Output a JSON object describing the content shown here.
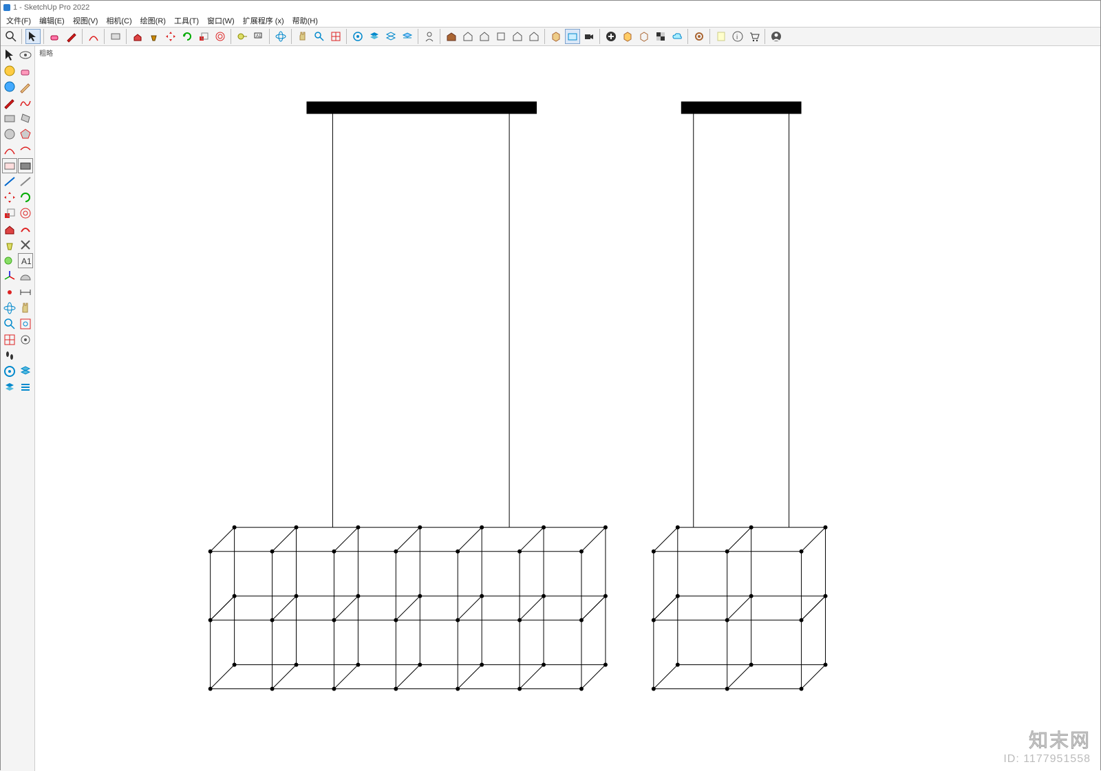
{
  "title": "1 - SketchUp Pro 2022",
  "menu": {
    "file": "文件(F)",
    "edit": "编辑(E)",
    "view": "视图(V)",
    "camera": "相机(C)",
    "draw": "绘图(R)",
    "tools": "工具(T)",
    "window": "窗口(W)",
    "extensions": "扩展程序 (x)",
    "help": "帮助(H)"
  },
  "canvas_label": "粗略",
  "watermark": {
    "brand": "知末网",
    "id_label": "ID: 1177951558"
  },
  "top_icons": [
    "search-icon",
    "select-arrow-icon",
    "eraser-icon",
    "pencil-icon",
    "arc-icon",
    "rectangle-icon",
    "pushpull-icon",
    "paintbucket-icon",
    "move-icon",
    "rotate-icon",
    "scale-icon",
    "offset-icon",
    "tape-icon",
    "text-label-icon",
    "orbit-icon",
    "pan-icon",
    "zoom-icon",
    "zoom-extents-icon",
    "outliner-icon",
    "layers-icon",
    "components-icon",
    "section-icon",
    "person-icon",
    "warehouse-icon",
    "home-icon",
    "house-front-icon",
    "house-top-icon",
    "house-side-icon",
    "house-back-icon",
    "box-icon",
    "capture-icon",
    "record-icon",
    "add-icon",
    "cube-icon",
    "cube-alt-icon",
    "checker-icon",
    "cloud-icon",
    "settings-icon",
    "document-icon",
    "info-icon",
    "cart-icon",
    "user-icon"
  ],
  "left_icons": [
    [
      "cursor-icon",
      "eye-icon"
    ],
    [
      "sphere-yellow-icon",
      "eraser-icon"
    ],
    [
      "sphere-blue-icon",
      "pencil-icon"
    ],
    [
      "pencil-red-icon",
      "freehand-icon"
    ],
    [
      "rectangle-icon",
      "rectangle-rotated-icon"
    ],
    [
      "circle-icon",
      "polygon-icon"
    ],
    [
      "arc-icon",
      "arc2-icon"
    ],
    [
      "rectangle-3d-icon",
      "rectangle-filled-icon"
    ],
    [
      "line-blue-icon",
      "line-gray-icon"
    ],
    [
      "move-red-icon",
      "rotate-green-icon"
    ],
    [
      "scale-icon",
      "offset-icon"
    ],
    [
      "pushpull-red-icon",
      "followme-icon"
    ],
    [
      "paintbucket-icon",
      "tools-cross-icon"
    ],
    [
      "tape-green-icon",
      "text-a-icon"
    ],
    [
      "axis-icon",
      "protractor-icon"
    ],
    [
      "dot-red-icon",
      "dimension-icon"
    ],
    [
      "orbit-icon",
      "pan-hand-icon"
    ],
    [
      "zoom-magnify-icon",
      "zoom-window-icon"
    ],
    [
      "zoom-extents-icon",
      "eye-target-icon"
    ],
    [
      "footprints-icon",
      ""
    ],
    [
      "outliner-blue-icon",
      "styles-icon"
    ],
    [
      "layers-blue-icon",
      "lines-icon"
    ]
  ]
}
